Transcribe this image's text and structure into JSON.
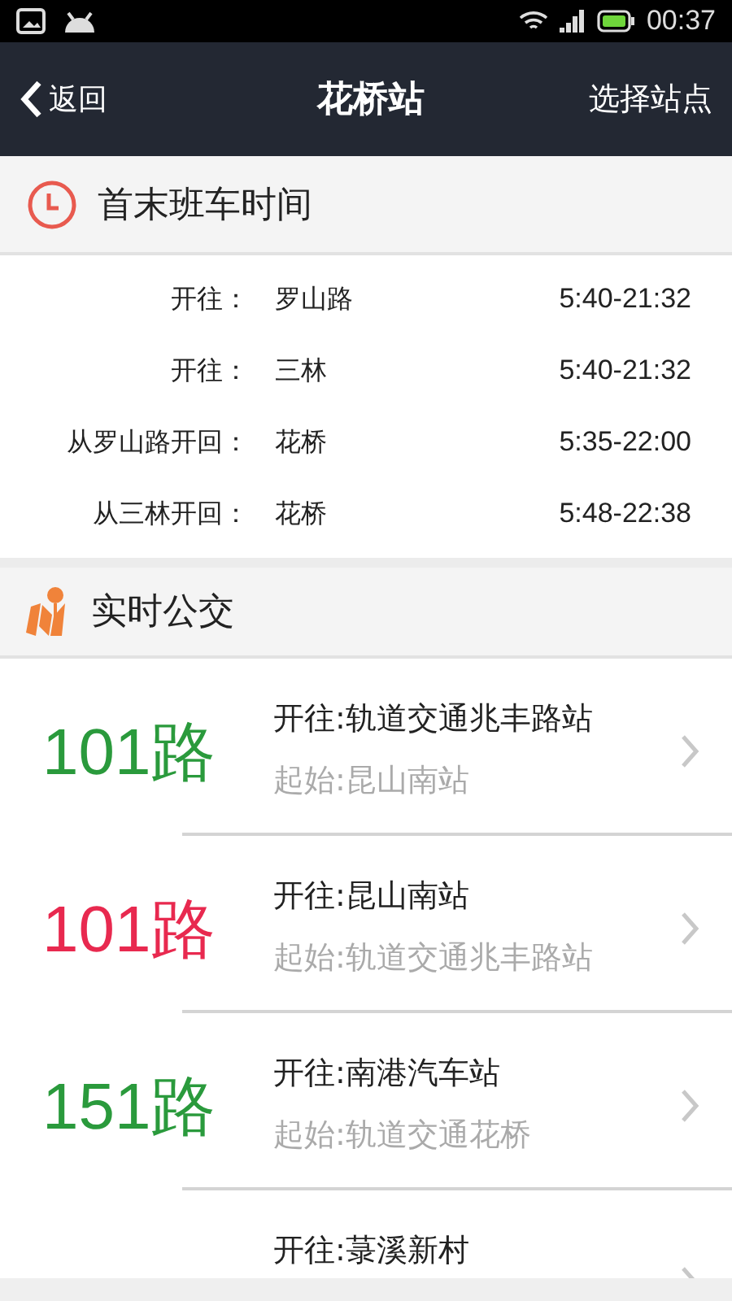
{
  "status_bar": {
    "time": "00:37"
  },
  "header": {
    "back": "返回",
    "title": "花桥站",
    "action": "选择站点"
  },
  "schedule": {
    "title": "首末班车时间",
    "rows": [
      {
        "label": "开往：",
        "stop": "罗山路",
        "hours": "5:40-21:32"
      },
      {
        "label": "开往：",
        "stop": "三林",
        "hours": "5:40-21:32"
      },
      {
        "label": "从罗山路开回：",
        "stop": "花桥",
        "hours": "5:35-22:00"
      },
      {
        "label": "从三林开回：",
        "stop": "花桥",
        "hours": "5:48-22:38"
      }
    ]
  },
  "realtime": {
    "title": "实时公交",
    "routes": [
      {
        "name": "101路",
        "color": "#2a9a3c",
        "to": "开往:轨道交通兆丰路站",
        "from": "起始:昆山南站"
      },
      {
        "name": "101路",
        "color": "#e8294f",
        "to": "开往:昆山南站",
        "from": "起始:轨道交通兆丰路站"
      },
      {
        "name": "151路",
        "color": "#2a9a3c",
        "to": "开往:南港汽车站",
        "from": "起始:轨道交通花桥"
      },
      {
        "to": "开往:菉溪新村"
      }
    ]
  }
}
